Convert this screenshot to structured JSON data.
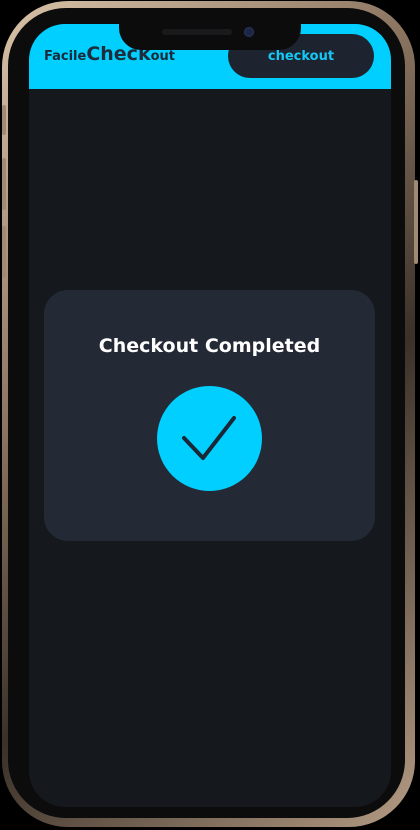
{
  "header": {
    "logo_prefix": "Facile",
    "logo_main": "Check",
    "logo_suffix": "out",
    "checkout_label": "checkout"
  },
  "card": {
    "title": "Checkout Completed",
    "status_icon": "checkmark-icon"
  },
  "colors": {
    "accent": "#00cfff",
    "background": "#15181d",
    "card": "#232a35",
    "button_bg": "#1d2430"
  }
}
